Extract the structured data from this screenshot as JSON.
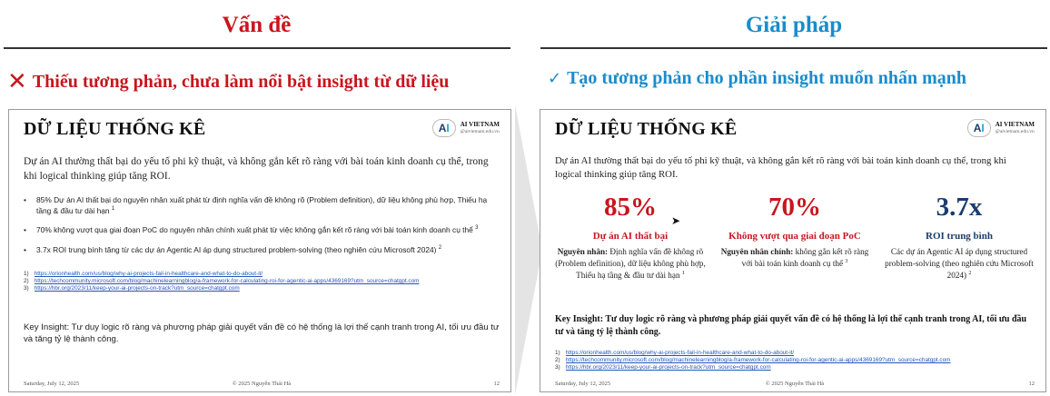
{
  "left": {
    "title": "Vấn đề",
    "caption": "Thiếu tương phản, chưa làm nổi bật insight từ dữ liệu",
    "caption_icon": "cross-icon"
  },
  "right": {
    "title": "Giải pháp",
    "caption": "Tạo tương phản cho phần insight muốn nhấn mạnh",
    "caption_icon": "check-icon"
  },
  "slide": {
    "title": "DỮ LIỆU THỐNG KÊ",
    "logo": {
      "badge": "AI",
      "name": "AI VIETNAM",
      "sub": "@aivietnam.edu.vn"
    },
    "intro": "Dự án AI thường thất bại do yếu tố phi kỹ thuật, và không gắn kết rõ ràng với bài toán kinh doanh cụ thể, trong khi logical thinking giúp tăng ROI.",
    "bullets": [
      "85% Dự án AI thất bại do nguyên nhân xuất phát từ định nghĩa vấn đề không rõ (Problem definition), dữ liệu không phù hợp, Thiếu hạ tầng & đầu tư dài hạn",
      "70% không vượt qua giai đoạn PoC do nguyên nhân chính xuất phát từ việc không gắn kết rõ ràng với bài toán kinh doanh cụ thể",
      "3.7x ROI trung bình tăng từ các dự án Agentic AI áp dụng structured problem-solving (theo nghiên cứu Microsoft 2024)"
    ],
    "bullet_refs": [
      "1",
      "3",
      "2"
    ],
    "references": [
      {
        "num": "1)",
        "url": "https://orionhealth.com/us/blog/why-ai-projects-fail-in-healthcare-and-what-to-do-about-it/"
      },
      {
        "num": "2)",
        "url": "https://techcommunity.microsoft.com/blog/machinelearningblog/a-framework-for-calculating-roi-for-agentic-ai-apps/4369169?utm_source=chatgpt.com"
      },
      {
        "num": "3)",
        "url": "https://hbr.org/2023/11/keep-your-ai-projects-on-track?utm_source=chatgpt.com"
      }
    ],
    "insight": "Key Insight: Tư duy logic rõ ràng và phương pháp giải quyết vấn đề có hệ thống là lợi thế cạnh tranh trong AI, tối ưu đầu tư và tăng tỷ lệ thành công.",
    "footer": {
      "date": "Saturday, July 12, 2025",
      "copyright": "© 2025 Nguyễn Thái Hà",
      "page": "12"
    }
  },
  "stats": [
    {
      "value": "85%",
      "label": "Dự án AI thất bại",
      "desc_bold": "Nguyên nhân:",
      "desc": "Định nghĩa vấn đề không rõ (Problem definition), dữ liệu không phù hợp, Thiếu hạ tầng & đầu tư dài hạn",
      "ref": "1"
    },
    {
      "value": "70%",
      "label": "Không vượt qua giai đoạn PoC",
      "desc_bold": "Nguyên nhân chính:",
      "desc": "không gắn kết rõ ràng với bài toán kinh doanh cụ thể",
      "ref": "3"
    },
    {
      "value": "3.7x",
      "label": "ROI trung bình",
      "desc_bold": "",
      "desc": "Các dự án Agentic AI áp dụng structured problem-solving (theo nghiên cứu Microsoft 2024)",
      "ref": "2"
    }
  ],
  "colors": {
    "problem": "#c8161d",
    "solution": "#1a8ccc",
    "navy": "#1b3d6d"
  }
}
